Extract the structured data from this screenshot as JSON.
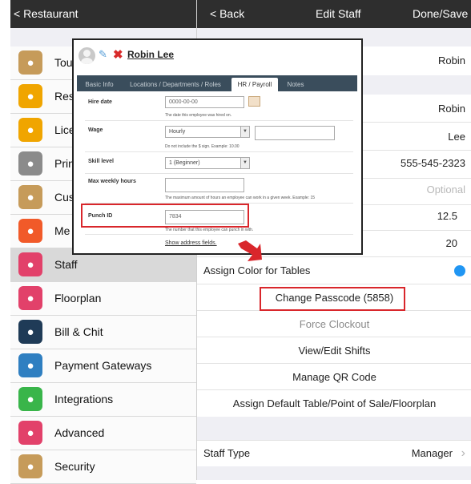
{
  "left_panel": {
    "back_label": "< Restaurant",
    "items": [
      {
        "label": "Tou",
        "icon": "chef-hat-icon",
        "color": "#c69b5a"
      },
      {
        "label": "Res",
        "icon": "store-icon",
        "color": "#f0a500"
      },
      {
        "label": "Lice",
        "icon": "cart-icon",
        "color": "#f0a500"
      },
      {
        "label": "Prin",
        "icon": "printer-icon",
        "color": "#8b8b8b"
      },
      {
        "label": "Cus",
        "icon": "cfd-icon",
        "color": "#c69b5a"
      },
      {
        "label": "Me",
        "icon": "menu-icon",
        "color": "#f15a29"
      },
      {
        "label": "Staff",
        "icon": "staff-icon",
        "color": "#e2416a"
      },
      {
        "label": "Floorplan",
        "icon": "floorplan-icon",
        "color": "#e2416a"
      },
      {
        "label": "Bill & Chit",
        "icon": "receipt-icon",
        "color": "#1f3b57"
      },
      {
        "label": "Payment Gateways",
        "icon": "card-icon",
        "color": "#2f7fc1"
      },
      {
        "label": "Integrations",
        "icon": "integrations-icon",
        "color": "#39b54a"
      },
      {
        "label": "Advanced",
        "icon": "gear-icon",
        "color": "#e2416a"
      },
      {
        "label": "Security",
        "icon": "lock-icon",
        "color": "#c69b5a"
      }
    ]
  },
  "right_panel": {
    "back_label": "< Back",
    "title": "Edit Staff",
    "done_label": "Done/Save",
    "values": {
      "display_name": "Robin",
      "first_name": "Robin",
      "last_name": "Lee",
      "phone": "555-545-2323",
      "optional_placeholder": "Optional",
      "hourly": "12.5",
      "max_hours": "20"
    },
    "assign_color_label": "Assign Color for Tables",
    "assign_color_value": "#2196f3",
    "actions": [
      {
        "label": "Change Passcode (5858)",
        "enabled": true
      },
      {
        "label": "Force Clockout",
        "enabled": false
      },
      {
        "label": "View/Edit Shifts",
        "enabled": true
      },
      {
        "label": "Manage QR Code",
        "enabled": true
      },
      {
        "label": "Assign Default Table/Point of Sale/Floorplan",
        "enabled": true
      }
    ],
    "staff_type_label": "Staff Type",
    "staff_type_value": "Manager",
    "chevron": "›"
  },
  "popup": {
    "name": "Robin Lee",
    "tabs": [
      "Basic Info",
      "Locations / Departments / Roles",
      "HR / Payroll",
      "Notes"
    ],
    "active_tab": "HR / Payroll",
    "fields": {
      "hire_date_label": "Hire date",
      "hire_date_value": "0000-00-00",
      "hire_date_help": "The date this employee was hired on.",
      "wage_label": "Wage",
      "wage_value": "Hourly",
      "wage_help": "Do not include the $ sign. Example: 10.00",
      "skill_label": "Skill level",
      "skill_value": "1 (Beginner)",
      "max_hours_label": "Max weekly hours",
      "max_hours_help": "The maximum amount of hours an employee can work in a given week. Example: 15",
      "punch_label": "Punch ID",
      "punch_value": "7834",
      "punch_help": "The number that this employee can punch in with.",
      "show_address": "Show address fields."
    }
  }
}
